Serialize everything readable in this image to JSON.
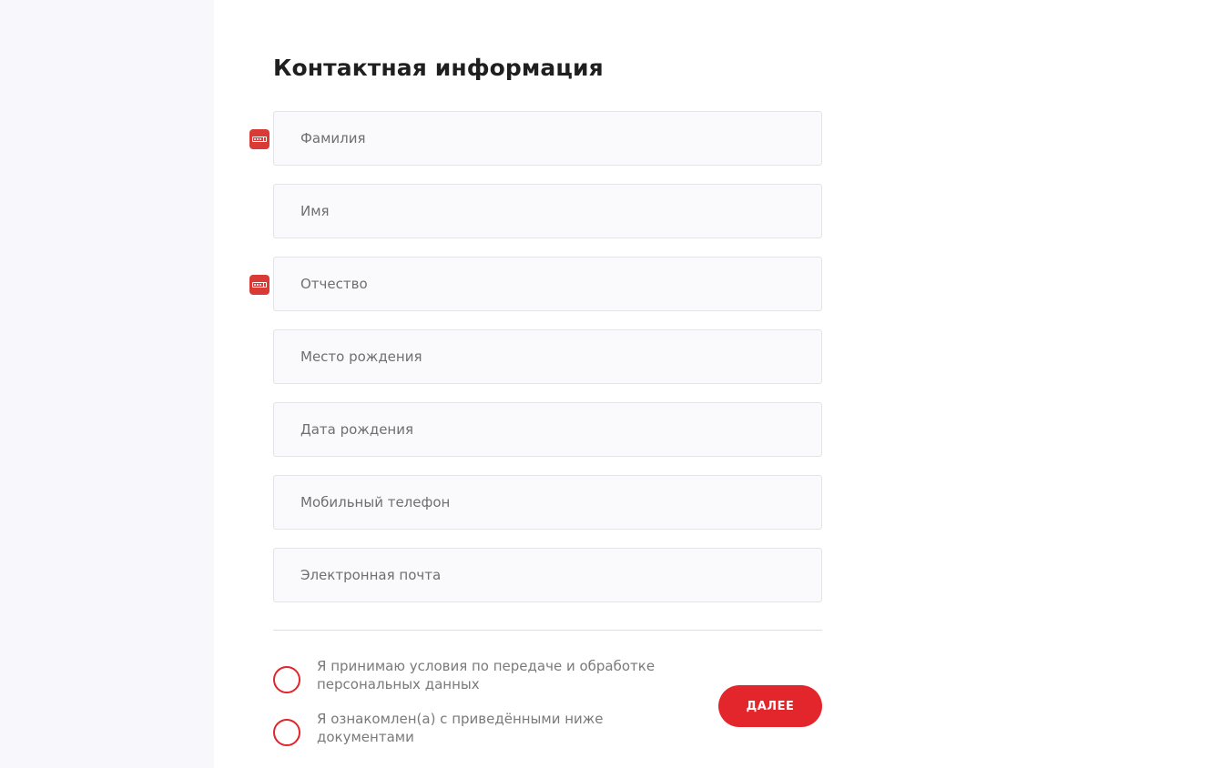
{
  "page": {
    "title": "Контактная информация"
  },
  "form": {
    "fields": [
      {
        "placeholder": "Фамилия",
        "value": "",
        "password_manager_icon": true
      },
      {
        "placeholder": "Имя",
        "value": "",
        "password_manager_icon": false
      },
      {
        "placeholder": "Отчество",
        "value": "",
        "password_manager_icon": true
      },
      {
        "placeholder": "Место рождения",
        "value": "",
        "password_manager_icon": false
      },
      {
        "placeholder": "Дата рождения",
        "value": "",
        "password_manager_icon": false
      },
      {
        "placeholder": "Мобильный телефон",
        "value": "",
        "password_manager_icon": false
      },
      {
        "placeholder": "Электронная почта",
        "value": "",
        "password_manager_icon": false
      }
    ]
  },
  "consents": [
    {
      "label": "Я принимаю условия по передаче и обработке персональных данных",
      "checked": false
    },
    {
      "label": "Я ознакомлен(а) с приведёнными ниже документами",
      "checked": false
    }
  ],
  "actions": {
    "next_label": "ДАЛЕЕ"
  },
  "icons": {
    "password_manager": "password-manager-icon"
  },
  "colors": {
    "accent": "#e3262c",
    "sidebar_bg": "#f7f7fc",
    "field_bg": "#fafafd"
  }
}
